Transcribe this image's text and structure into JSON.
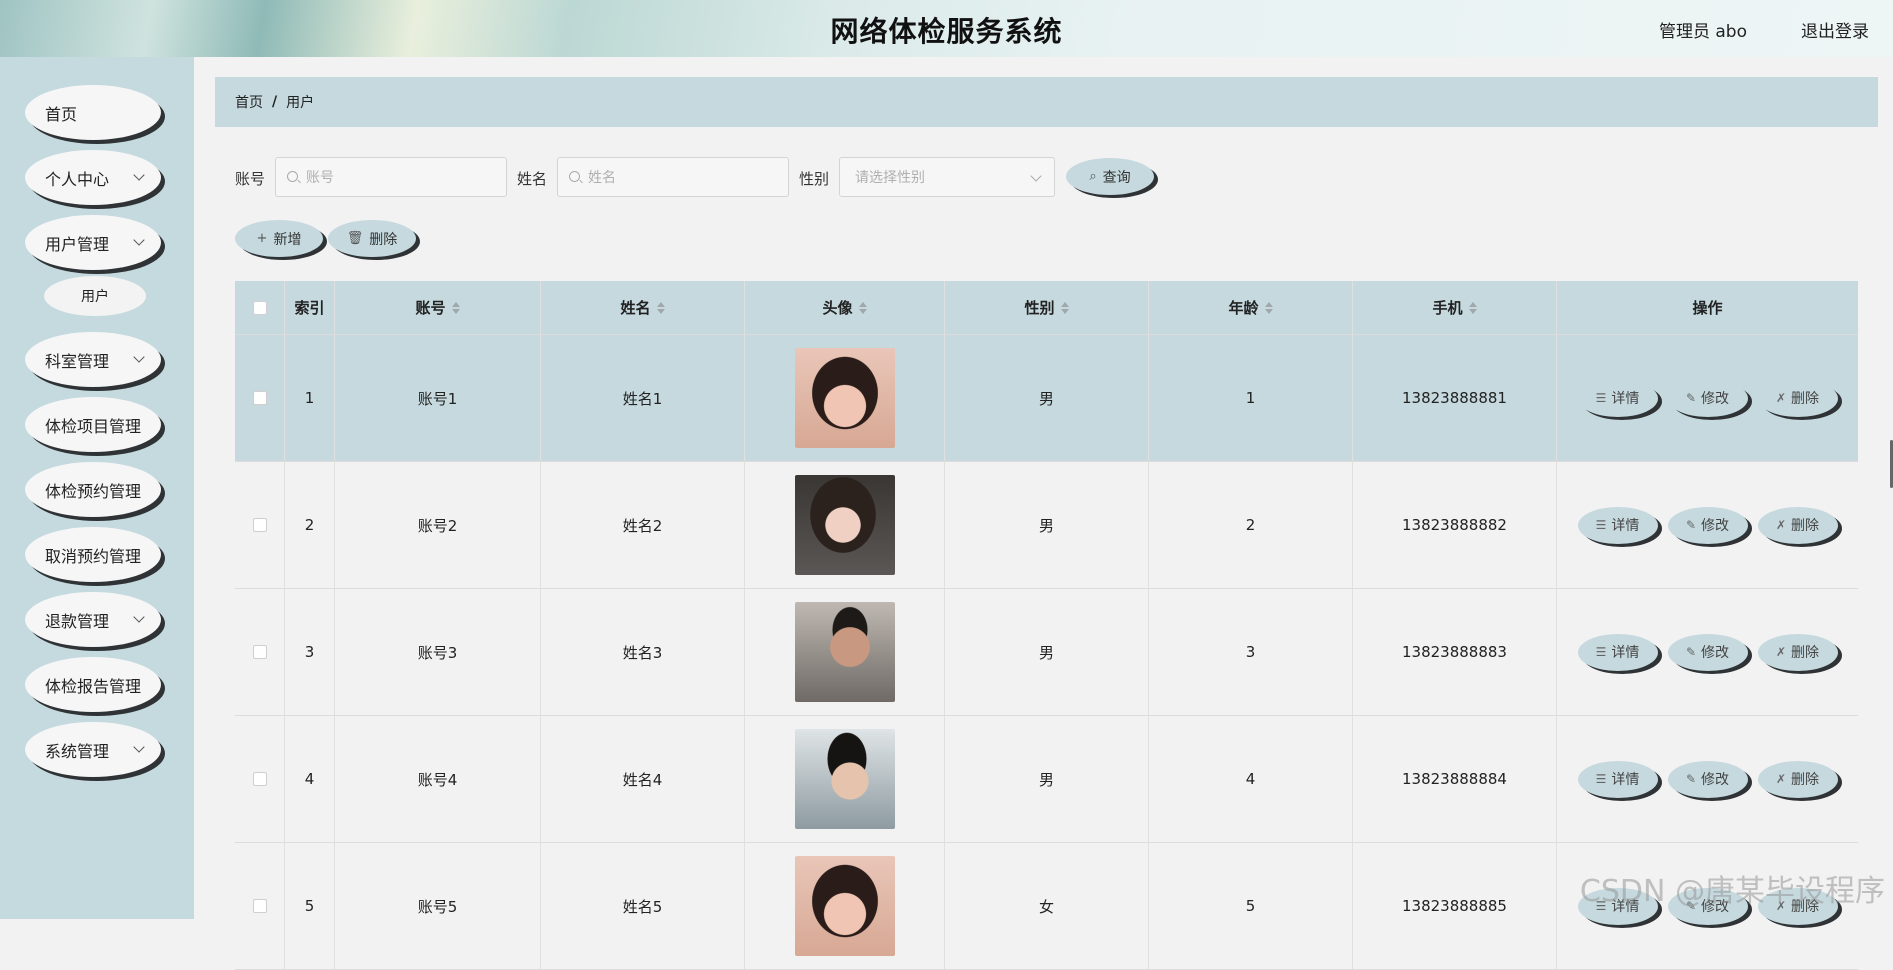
{
  "header": {
    "title": "网络体检服务系统",
    "user_label": "管理员 abo",
    "logout_label": "退出登录"
  },
  "sidebar": {
    "items": [
      {
        "label": "首页"
      },
      {
        "label": "个人中心"
      },
      {
        "label": "用户管理"
      },
      {
        "label": "科室管理"
      },
      {
        "label": "体检项目管理"
      },
      {
        "label": "体检预约管理"
      },
      {
        "label": "取消预约管理"
      },
      {
        "label": "退款管理"
      },
      {
        "label": "体检报告管理"
      },
      {
        "label": "系统管理"
      }
    ],
    "sub_item": "用户"
  },
  "breadcrumb": {
    "home": "首页",
    "sep": "/",
    "current": "用户"
  },
  "search": {
    "account_label": "账号",
    "account_placeholder": "账号",
    "name_label": "姓名",
    "name_placeholder": "姓名",
    "gender_label": "性别",
    "gender_placeholder": "请选择性别",
    "query_button": "查询"
  },
  "toolbar": {
    "add_button": "新增",
    "delete_button": "删除"
  },
  "table": {
    "headers": {
      "index": "索引",
      "account": "账号",
      "name": "姓名",
      "avatar": "头像",
      "gender": "性别",
      "age": "年龄",
      "phone": "手机",
      "ops": "操作"
    },
    "rows": [
      {
        "index": "1",
        "account": "账号1",
        "name": "姓名1",
        "gender": "男",
        "age": "1",
        "phone": "13823888881"
      },
      {
        "index": "2",
        "account": "账号2",
        "name": "姓名2",
        "gender": "男",
        "age": "2",
        "phone": "13823888882"
      },
      {
        "index": "3",
        "account": "账号3",
        "name": "姓名3",
        "gender": "男",
        "age": "3",
        "phone": "13823888883"
      },
      {
        "index": "4",
        "account": "账号4",
        "name": "姓名4",
        "gender": "男",
        "age": "4",
        "phone": "13823888884"
      },
      {
        "index": "5",
        "account": "账号5",
        "name": "姓名5",
        "gender": "女",
        "age": "5",
        "phone": "13823888885"
      }
    ],
    "actions": {
      "detail": "详情",
      "edit": "修改",
      "delete": "删除"
    }
  },
  "watermark": "CSDN @唐某毕设程序",
  "colors": {
    "accent": "#c5d9de",
    "sidebar": "#c5dadf",
    "pill_shadow": "#2f3336"
  }
}
